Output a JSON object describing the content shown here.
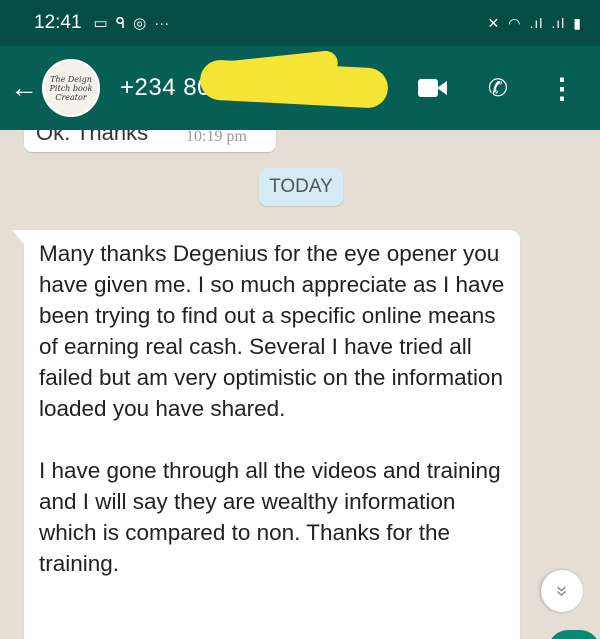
{
  "status_bar": {
    "time": "12:41",
    "left_icons": [
      "screen-icon",
      "app-icon",
      "instagram-icon",
      "more-dots-icon"
    ],
    "right_icons": [
      "mute-icon",
      "wifi-icon",
      "signal-icon",
      "signal-icon-2",
      "battery-icon"
    ]
  },
  "header": {
    "contact_visible": "+234 80",
    "avatar_text": "The Deign Pitch book Creator",
    "colors": {
      "app_bar": "#075e54",
      "status_bar": "#054d44",
      "redaction": "#f6e534"
    }
  },
  "chat": {
    "previous_message": {
      "text": "Ok. Thanks",
      "time": "10:19 pm"
    },
    "date_divider": "TODAY",
    "message": {
      "paragraphs": [
        "Many thanks Degenius for the eye opener you have given me. I so much appreciate as I have been trying to find out a specific online means of earning real cash. Several I have tried all failed but am very optimistic on the information loaded you have shared.",
        "I have gone through all the videos and training and I will say they are wealthy information which is compared to non. Thanks for the training."
      ]
    },
    "scroll_down_icon": "double-chevron-down-icon"
  }
}
